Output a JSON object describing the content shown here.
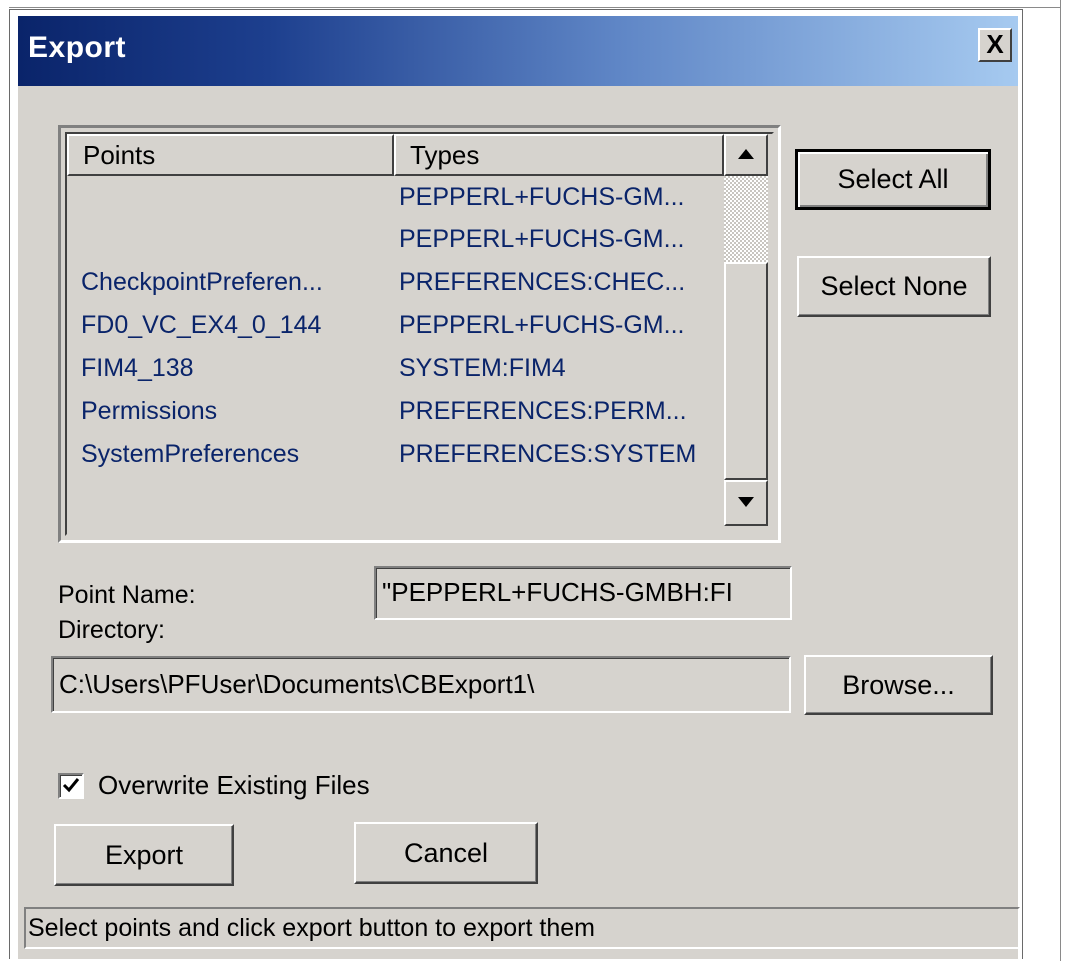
{
  "window": {
    "title": "Export",
    "close_glyph": "X"
  },
  "list": {
    "columns": [
      "Points",
      "Types"
    ],
    "rows": [
      {
        "point": "",
        "type": "PEPPERL+FUCHS-GM..."
      },
      {
        "point": "",
        "type": "PEPPERL+FUCHS-GM..."
      },
      {
        "point": "CheckpointPreferen...",
        "type": "PREFERENCES:CHEC..."
      },
      {
        "point": "FD0_VC_EX4_0_144",
        "type": "PEPPERL+FUCHS-GM..."
      },
      {
        "point": "FIM4_138",
        "type": "SYSTEM:FIM4"
      },
      {
        "point": "Permissions",
        "type": "PREFERENCES:PERM..."
      },
      {
        "point": "SystemPreferences",
        "type": "PREFERENCES:SYSTEM"
      }
    ],
    "scroll_up_icon": "triangle-up",
    "scroll_down_icon": "triangle-down"
  },
  "buttons": {
    "select_all": "Select All",
    "select_none": "Select None",
    "browse": "Browse...",
    "export": "Export",
    "cancel": "Cancel"
  },
  "fields": {
    "point_name_label": "Point Name:",
    "point_name_value": "\"PEPPERL+FUCHS-GMBH:FI",
    "directory_label": "Directory:",
    "directory_value": "C:\\Users\\PFUser\\Documents\\CBExport1\\"
  },
  "options": {
    "overwrite_label": "Overwrite Existing Files",
    "overwrite_checked": true
  },
  "status": {
    "text": "Select points and click export button to export them"
  }
}
